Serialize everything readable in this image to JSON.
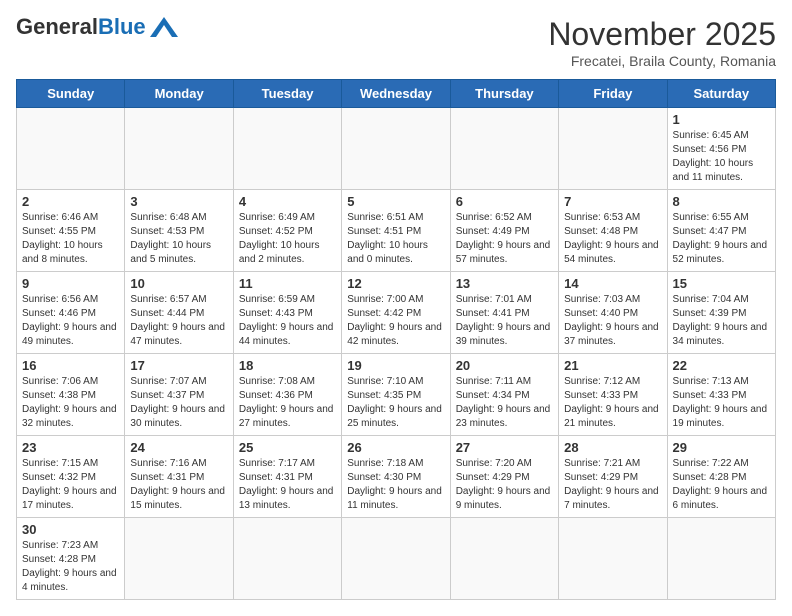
{
  "header": {
    "logo_general": "General",
    "logo_blue": "Blue",
    "month_title": "November 2025",
    "location": "Frecatei, Braila County, Romania"
  },
  "weekdays": [
    "Sunday",
    "Monday",
    "Tuesday",
    "Wednesday",
    "Thursday",
    "Friday",
    "Saturday"
  ],
  "weeks": [
    [
      {
        "day": "",
        "info": ""
      },
      {
        "day": "",
        "info": ""
      },
      {
        "day": "",
        "info": ""
      },
      {
        "day": "",
        "info": ""
      },
      {
        "day": "",
        "info": ""
      },
      {
        "day": "",
        "info": ""
      },
      {
        "day": "1",
        "info": "Sunrise: 6:45 AM\nSunset: 4:56 PM\nDaylight: 10 hours and 11 minutes."
      }
    ],
    [
      {
        "day": "2",
        "info": "Sunrise: 6:46 AM\nSunset: 4:55 PM\nDaylight: 10 hours and 8 minutes."
      },
      {
        "day": "3",
        "info": "Sunrise: 6:48 AM\nSunset: 4:53 PM\nDaylight: 10 hours and 5 minutes."
      },
      {
        "day": "4",
        "info": "Sunrise: 6:49 AM\nSunset: 4:52 PM\nDaylight: 10 hours and 2 minutes."
      },
      {
        "day": "5",
        "info": "Sunrise: 6:51 AM\nSunset: 4:51 PM\nDaylight: 10 hours and 0 minutes."
      },
      {
        "day": "6",
        "info": "Sunrise: 6:52 AM\nSunset: 4:49 PM\nDaylight: 9 hours and 57 minutes."
      },
      {
        "day": "7",
        "info": "Sunrise: 6:53 AM\nSunset: 4:48 PM\nDaylight: 9 hours and 54 minutes."
      },
      {
        "day": "8",
        "info": "Sunrise: 6:55 AM\nSunset: 4:47 PM\nDaylight: 9 hours and 52 minutes."
      }
    ],
    [
      {
        "day": "9",
        "info": "Sunrise: 6:56 AM\nSunset: 4:46 PM\nDaylight: 9 hours and 49 minutes."
      },
      {
        "day": "10",
        "info": "Sunrise: 6:57 AM\nSunset: 4:44 PM\nDaylight: 9 hours and 47 minutes."
      },
      {
        "day": "11",
        "info": "Sunrise: 6:59 AM\nSunset: 4:43 PM\nDaylight: 9 hours and 44 minutes."
      },
      {
        "day": "12",
        "info": "Sunrise: 7:00 AM\nSunset: 4:42 PM\nDaylight: 9 hours and 42 minutes."
      },
      {
        "day": "13",
        "info": "Sunrise: 7:01 AM\nSunset: 4:41 PM\nDaylight: 9 hours and 39 minutes."
      },
      {
        "day": "14",
        "info": "Sunrise: 7:03 AM\nSunset: 4:40 PM\nDaylight: 9 hours and 37 minutes."
      },
      {
        "day": "15",
        "info": "Sunrise: 7:04 AM\nSunset: 4:39 PM\nDaylight: 9 hours and 34 minutes."
      }
    ],
    [
      {
        "day": "16",
        "info": "Sunrise: 7:06 AM\nSunset: 4:38 PM\nDaylight: 9 hours and 32 minutes."
      },
      {
        "day": "17",
        "info": "Sunrise: 7:07 AM\nSunset: 4:37 PM\nDaylight: 9 hours and 30 minutes."
      },
      {
        "day": "18",
        "info": "Sunrise: 7:08 AM\nSunset: 4:36 PM\nDaylight: 9 hours and 27 minutes."
      },
      {
        "day": "19",
        "info": "Sunrise: 7:10 AM\nSunset: 4:35 PM\nDaylight: 9 hours and 25 minutes."
      },
      {
        "day": "20",
        "info": "Sunrise: 7:11 AM\nSunset: 4:34 PM\nDaylight: 9 hours and 23 minutes."
      },
      {
        "day": "21",
        "info": "Sunrise: 7:12 AM\nSunset: 4:33 PM\nDaylight: 9 hours and 21 minutes."
      },
      {
        "day": "22",
        "info": "Sunrise: 7:13 AM\nSunset: 4:33 PM\nDaylight: 9 hours and 19 minutes."
      }
    ],
    [
      {
        "day": "23",
        "info": "Sunrise: 7:15 AM\nSunset: 4:32 PM\nDaylight: 9 hours and 17 minutes."
      },
      {
        "day": "24",
        "info": "Sunrise: 7:16 AM\nSunset: 4:31 PM\nDaylight: 9 hours and 15 minutes."
      },
      {
        "day": "25",
        "info": "Sunrise: 7:17 AM\nSunset: 4:31 PM\nDaylight: 9 hours and 13 minutes."
      },
      {
        "day": "26",
        "info": "Sunrise: 7:18 AM\nSunset: 4:30 PM\nDaylight: 9 hours and 11 minutes."
      },
      {
        "day": "27",
        "info": "Sunrise: 7:20 AM\nSunset: 4:29 PM\nDaylight: 9 hours and 9 minutes."
      },
      {
        "day": "28",
        "info": "Sunrise: 7:21 AM\nSunset: 4:29 PM\nDaylight: 9 hours and 7 minutes."
      },
      {
        "day": "29",
        "info": "Sunrise: 7:22 AM\nSunset: 4:28 PM\nDaylight: 9 hours and 6 minutes."
      }
    ],
    [
      {
        "day": "30",
        "info": "Sunrise: 7:23 AM\nSunset: 4:28 PM\nDaylight: 9 hours and 4 minutes."
      },
      {
        "day": "",
        "info": ""
      },
      {
        "day": "",
        "info": ""
      },
      {
        "day": "",
        "info": ""
      },
      {
        "day": "",
        "info": ""
      },
      {
        "day": "",
        "info": ""
      },
      {
        "day": "",
        "info": ""
      }
    ]
  ]
}
